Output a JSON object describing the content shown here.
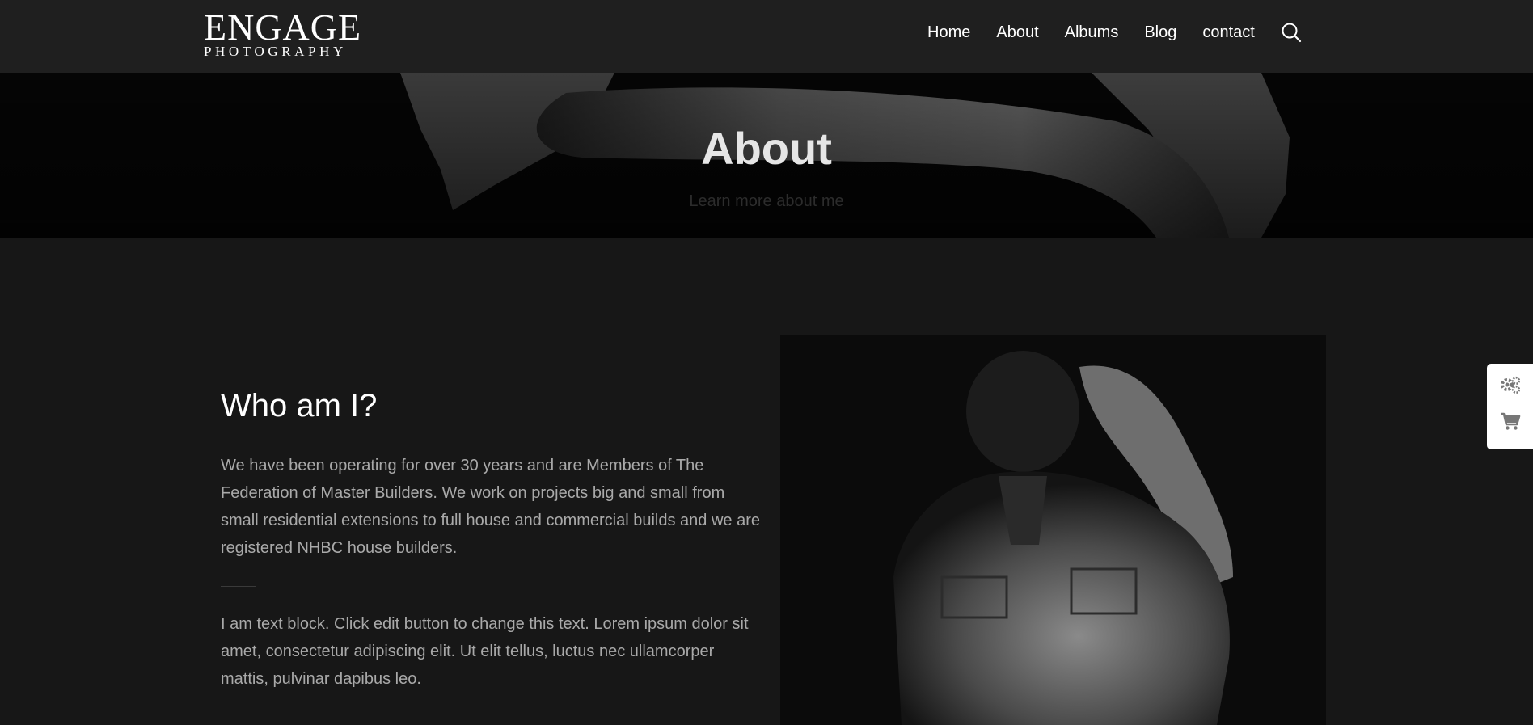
{
  "brand": {
    "logo_main": "ENGAGE",
    "logo_sub": "PHOTOGRAPHY"
  },
  "nav": {
    "items": [
      {
        "label": "Home"
      },
      {
        "label": "About"
      },
      {
        "label": "Albums"
      },
      {
        "label": "Blog"
      },
      {
        "label": "contact"
      }
    ],
    "search_icon": "search-icon"
  },
  "hero": {
    "title": "About",
    "subtitle": "Learn more about me"
  },
  "content": {
    "heading": "Who am I?",
    "paragraph1": "We have been operating for over 30 years and are Members of The Federation of Master Builders. We work on projects big and small from small residential extensions to full house and commercial builds and we are registered NHBC house builders.",
    "paragraph2": "I am text block. Click edit button to change this text. Lorem ipsum dolor sit amet, consectetur adipiscing elit. Ut elit tellus, luctus nec ullamcorper mattis, pulvinar dapibus leo."
  },
  "side_widget": {
    "icons": [
      "gears-icon",
      "cart-icon"
    ]
  },
  "colors": {
    "header_bg": "#1f1f1f",
    "page_bg": "#171717",
    "body_text": "#a9a9a9"
  }
}
